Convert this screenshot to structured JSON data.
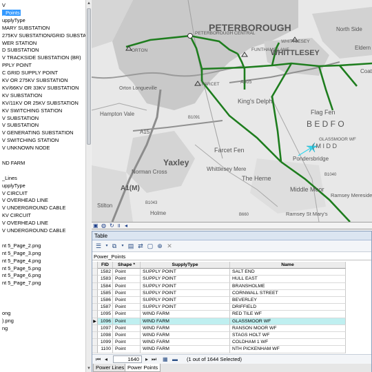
{
  "toc": {
    "items": [
      {
        "label": "V",
        "selected": false
      },
      {
        "label": "_Points",
        "selected": true
      },
      {
        "label": "upplyType",
        "selected": false
      },
      {
        "label": "MARY SUBSTATION",
        "selected": false
      },
      {
        "label": "275KV SUBSTATION/GRID SUBSTAT",
        "selected": false
      },
      {
        "label": "WER STATION",
        "selected": false
      },
      {
        "label": "D SUBSTATION",
        "selected": false
      },
      {
        "label": "V TRACKSIDE SUBSTATION (BR)",
        "selected": false
      },
      {
        "label": "PPLY POINT",
        "selected": false
      },
      {
        "label": "C GRID SUPPLY POINT",
        "selected": false
      },
      {
        "label": "KV OR 275KV SUBSTATION",
        "selected": false
      },
      {
        "label": "KV/66KV OR 33KV SUBSTATION",
        "selected": false
      },
      {
        "label": "KV SUBSTATION",
        "selected": false
      },
      {
        "label": "KV/11KV OR 25KV SUBSTATION",
        "selected": false
      },
      {
        "label": "KV SWITCHING STATION",
        "selected": false
      },
      {
        "label": "V SUBSTATION",
        "selected": false
      },
      {
        "label": "V SUBSTATION",
        "selected": false
      },
      {
        "label": "V GENERATING SUBSTATION",
        "selected": false
      },
      {
        "label": "V SWITCHING STATION",
        "selected": false
      },
      {
        "label": "V UNKNOWN NODE",
        "selected": false
      },
      {
        "label": "",
        "selected": false
      },
      {
        "label": "ND FARM",
        "selected": false
      },
      {
        "label": "",
        "selected": false
      },
      {
        "label": "_Lines",
        "selected": false
      },
      {
        "label": "upplyType",
        "selected": false
      },
      {
        "label": "V CIRCUIT",
        "selected": false
      },
      {
        "label": "V OVERHEAD LINE",
        "selected": false
      },
      {
        "label": "V UNDERGROUND CABLE",
        "selected": false
      },
      {
        "label": "KV CIRCUIT",
        "selected": false
      },
      {
        "label": "V OVERHEAD LINE",
        "selected": false
      },
      {
        "label": "V UNDERGROUND CABLE",
        "selected": false
      },
      {
        "label": "",
        "selected": false
      },
      {
        "label": "nt 5_Page_2.png",
        "selected": false
      },
      {
        "label": "nt 5_Page_3.png",
        "selected": false
      },
      {
        "label": "nt 5_Page_4.png",
        "selected": false
      },
      {
        "label": "nt 5_Page_5.png",
        "selected": false
      },
      {
        "label": "nt 5_Page_6.png",
        "selected": false
      },
      {
        "label": "nt 5_Page_7.png",
        "selected": false
      },
      {
        "label": "",
        "selected": false
      },
      {
        "label": "",
        "selected": false
      },
      {
        "label": "",
        "selected": false
      },
      {
        "label": "ong",
        "selected": false
      },
      {
        "label": ").png",
        "selected": false
      },
      {
        "label": "ng",
        "selected": false
      }
    ]
  },
  "map": {
    "labels": {
      "peterborough": "PETERBOROUGH",
      "peterborough_central": "PETERBOROUGH CENTRAL",
      "whittlesey_sub": "WHITTLESEY",
      "whittlesey": "WHITTLESEY",
      "funthams_lane": "FUNTHAMS LANE",
      "orton": "ORTON",
      "farcet": "FARCET",
      "glassmoor_wf": "GLASSMOOR WF",
      "kings_delph": "King's Delph",
      "flag_fen": "Flag Fen",
      "bedford": "B E D F O",
      "middle": "( M I D D",
      "farcet_fen": "Farcet Fen",
      "pondersbridge": "Pondersbridge",
      "yaxley": "Yaxley",
      "whittlesey_mere": "Whittlesey Mere",
      "the_herne": "The Herne",
      "middle_moor": "Middle Moor",
      "ramsey_mereside": "Ramsey Mereside",
      "ramsey_st_marys": "Ramsey St Mary's",
      "norman_cross": "Norman Cross",
      "stilton": "Stilton",
      "holme": "Holme",
      "hampton_vale": "Hampton Vale",
      "orton_longueville": "Orton Longueville",
      "north_side": "North Side",
      "eldern": "Eldern",
      "coat": "Coat",
      "a15": "A15",
      "a1m": "A1(M)",
      "a605": "A605",
      "b1091": "B1091",
      "b1040": "B1040",
      "b660": "B660",
      "b1043": "B1043"
    }
  },
  "table": {
    "title": "Table",
    "layer_header": "Power_Points",
    "columns": [
      "FID",
      "Shape *",
      "SupplyType",
      "Name"
    ],
    "rows": [
      {
        "fid": "1582",
        "shape": "Point",
        "type": "SUPPLY POINT",
        "name": "SALT END",
        "selected": false
      },
      {
        "fid": "1583",
        "shape": "Point",
        "type": "SUPPLY POINT",
        "name": "HULL EAST",
        "selected": false
      },
      {
        "fid": "1584",
        "shape": "Point",
        "type": "SUPPLY POINT",
        "name": "BRANSHOLME",
        "selected": false
      },
      {
        "fid": "1585",
        "shape": "Point",
        "type": "SUPPLY POINT",
        "name": "CORNWALL STREET",
        "selected": false
      },
      {
        "fid": "1586",
        "shape": "Point",
        "type": "SUPPLY POINT",
        "name": "BEVERLEY",
        "selected": false
      },
      {
        "fid": "1587",
        "shape": "Point",
        "type": "SUPPLY POINT",
        "name": "DRIFFIELD",
        "selected": false
      },
      {
        "fid": "1095",
        "shape": "Point",
        "type": "WIND FARM",
        "name": "RED TILE WF",
        "selected": false
      },
      {
        "fid": "1096",
        "shape": "Point",
        "type": "WIND FARM",
        "name": "GLASSMOOR WF",
        "selected": true
      },
      {
        "fid": "1097",
        "shape": "Point",
        "type": "WIND FARM",
        "name": "RANSON MOOR WF",
        "selected": false
      },
      {
        "fid": "1098",
        "shape": "Point",
        "type": "WIND FARM",
        "name": "STAGS HOLT WF",
        "selected": false
      },
      {
        "fid": "1099",
        "shape": "Point",
        "type": "WIND FARM",
        "name": "COLDHAM 1 WF",
        "selected": false
      },
      {
        "fid": "1100",
        "shape": "Point",
        "type": "WIND FARM",
        "name": "NTH PICKENHAM WF",
        "selected": false
      }
    ],
    "nav": {
      "record": "1640",
      "selection": "(1 out of 1644 Selected)"
    },
    "tabs": [
      "Power Lines",
      "Power Points"
    ],
    "active_tab": "Power Points"
  },
  "colors": {
    "power_line": "#1e7d1e",
    "selected_point": "#33d6ee",
    "selected_row": "#bfeff0",
    "toc_selection": "#3399ff"
  }
}
